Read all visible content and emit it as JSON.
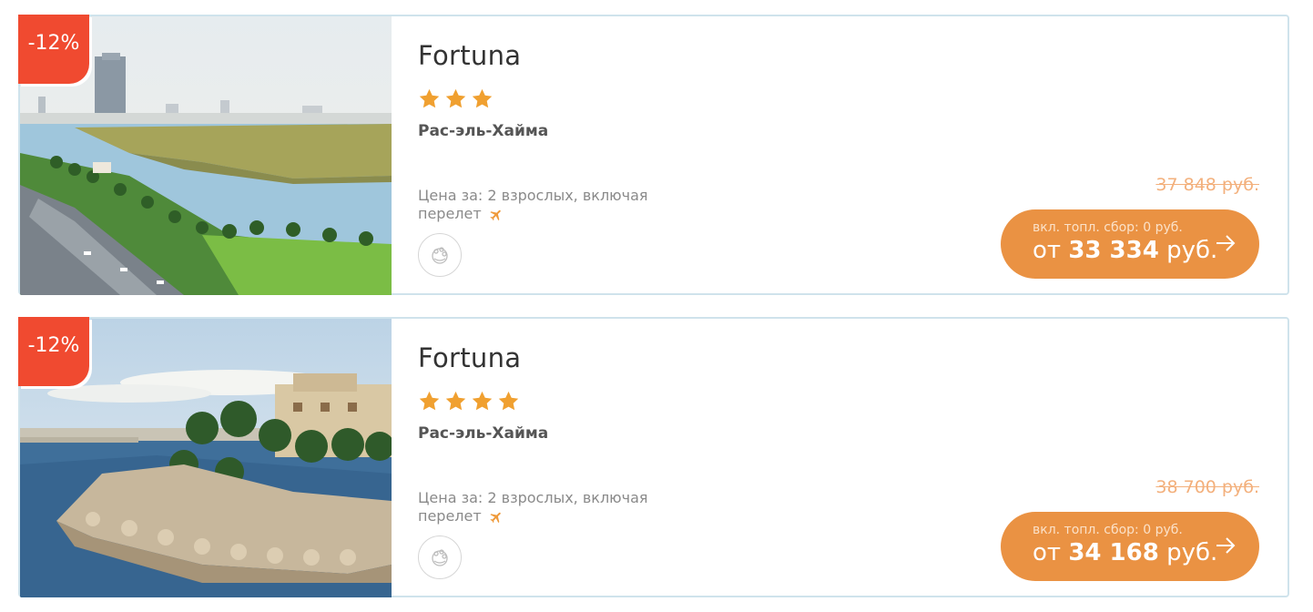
{
  "hotels": [
    {
      "discount": "-12%",
      "name": "Fortuna",
      "stars": 3,
      "city": "Рас-эль-Хайма",
      "price_for": "Цена за: 2 взрослых, включая перелет",
      "old_price": "37 848 руб.",
      "fuel_note": "вкл. топл. сбор: 0 руб.",
      "price_prefix": "от",
      "price_value": "33 334",
      "price_currency": "руб."
    },
    {
      "discount": "-12%",
      "name": "Fortuna",
      "stars": 4,
      "city": "Рас-эль-Хайма",
      "price_for": "Цена за: 2 взрослых, включая перелет",
      "old_price": "38 700 руб.",
      "fuel_note": "вкл. топл. сбор: 0 руб.",
      "price_prefix": "от",
      "price_value": "34 168",
      "price_currency": "руб."
    }
  ],
  "colors": {
    "accent": "#ea9243",
    "badge": "#f04a30",
    "star": "#f0a030",
    "border": "#cfe3ec"
  },
  "icons": [
    "star-icon",
    "plane-icon",
    "meal-icon",
    "arrow-right-icon"
  ]
}
